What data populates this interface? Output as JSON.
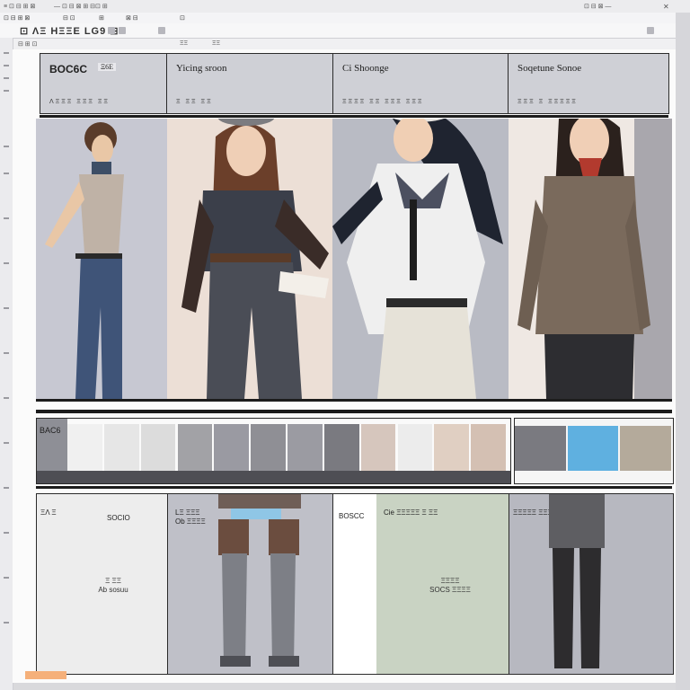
{
  "window": {
    "title_left": "≡  ⊡ ⊟ ⊞ ⊠",
    "title_mid": "—  ⊡  ⊟ ⊠  ⊞ ⊟⊡ ⊞",
    "title_right": "⊡ ⊟ ⊠ —"
  },
  "menubar": {
    "items": [
      "⊡ ⊟ ⊞ ⊠",
      "⊟ ⊡",
      "⊞",
      "⊠ ⊟",
      "⊡"
    ]
  },
  "toolbar": {
    "logo": "⊡ ΛΞ ΗΞΞΕ LG9 ⊟"
  },
  "subbar": {
    "items": [
      "⊟ ⊞ ⊡",
      "ΞΞ",
      "ΞΞ"
    ]
  },
  "headers": [
    {
      "title": "BOC6C",
      "subtitle": "ΛΞΞΞ ΞΞΞ ΞΞ",
      "tag": "Ξ6Ε"
    },
    {
      "title": "Yicing sroon",
      "subtitle": "Ξ ΞΞ  ΞΞ"
    },
    {
      "title": "Ci Shoonge",
      "subtitle": "ΞΞΞΞ ΞΞ ΞΞΞ ΞΞΞ"
    },
    {
      "title": "Soqetune Sonoe",
      "subtitle": "ΞΞΞ Ξ ΞΞΞΞΞ"
    }
  ],
  "swatches": {
    "left_label": "BAC6",
    "colors_main": [
      "#f0f0f0",
      "#e6e6e6",
      "#dcdcdc",
      "#a2a2a6",
      "#9a9aa2",
      "#8f8f95",
      "#9b9ba2",
      "#7a7a80",
      "#d6c6bd",
      "#ececec",
      "#e0cfc2",
      "#d4c0b3"
    ],
    "colors_right": [
      "#7a7a80",
      "#5fb0e0",
      "#b4aa9b"
    ]
  },
  "bottom_cards": [
    {
      "label": "ΞΛ Ξ",
      "title": "SOCIO",
      "note_line1": "Ξ ΞΞ",
      "note_line2": "Ab sosuu"
    },
    {
      "label": "LΞ ΞΞΞ",
      "title": "Ob ΞΞΞΞ"
    },
    {
      "label": "BOSCC",
      "title": "Cie ΞΞΞΞΞ Ξ ΞΞ",
      "note_line1": "ΞΞΞΞ",
      "note_line2": "SOCS ΞΞΞΞ"
    },
    {
      "label": "ΞΞΞΞΞ ΞΞΞΞ Ξ Ξ"
    }
  ],
  "colors": {
    "header_bg": "#cfd0d6",
    "canvas_bg": "#fbfbfb",
    "panel_bg_light": "#efe8e3",
    "panel_bg_gray": "#b9bbc4",
    "accent_orange": "#f5b07a"
  },
  "icons": [
    "window-menu-icon",
    "minimize-icon",
    "close-icon",
    "tool-icon"
  ]
}
